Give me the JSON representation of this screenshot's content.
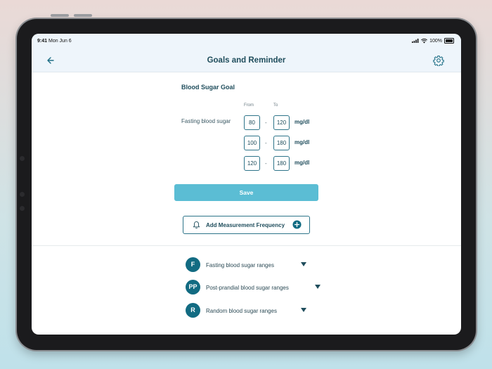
{
  "status_bar": {
    "time": "9:41",
    "date": "Mon Jun 6",
    "battery": "100%"
  },
  "app_bar": {
    "title": "Goals and Reminder"
  },
  "blood_sugar_goal": {
    "title": "Blood Sugar Goal",
    "from_label": "From",
    "to_label": "To",
    "rows": [
      {
        "label": "Fasting blood sugar",
        "from": "80",
        "to": "120",
        "unit": "mg/dl"
      },
      {
        "label": "",
        "from": "100",
        "to": "180",
        "unit": "mg/dl"
      },
      {
        "label": "",
        "from": "120",
        "to": "180",
        "unit": "mg/dl"
      }
    ],
    "separator": "-"
  },
  "save_label": "Save",
  "add_frequency_label": "Add Measurement Frequency",
  "ranges": [
    {
      "badge": "F",
      "label": "Fasting blood sugar ranges"
    },
    {
      "badge": "PP",
      "label": "Post-prandial blood sugar ranges"
    },
    {
      "badge": "R",
      "label": "Random blood sugar ranges"
    }
  ],
  "colors": {
    "accent": "#126b82",
    "save_button": "#5bbdd4",
    "title": "#1f4d5c"
  },
  "icons": {
    "back": "arrow-left-icon",
    "settings": "gear-icon",
    "bell": "bell-icon",
    "add": "plus-circle-icon",
    "expand": "caret-down-icon"
  }
}
